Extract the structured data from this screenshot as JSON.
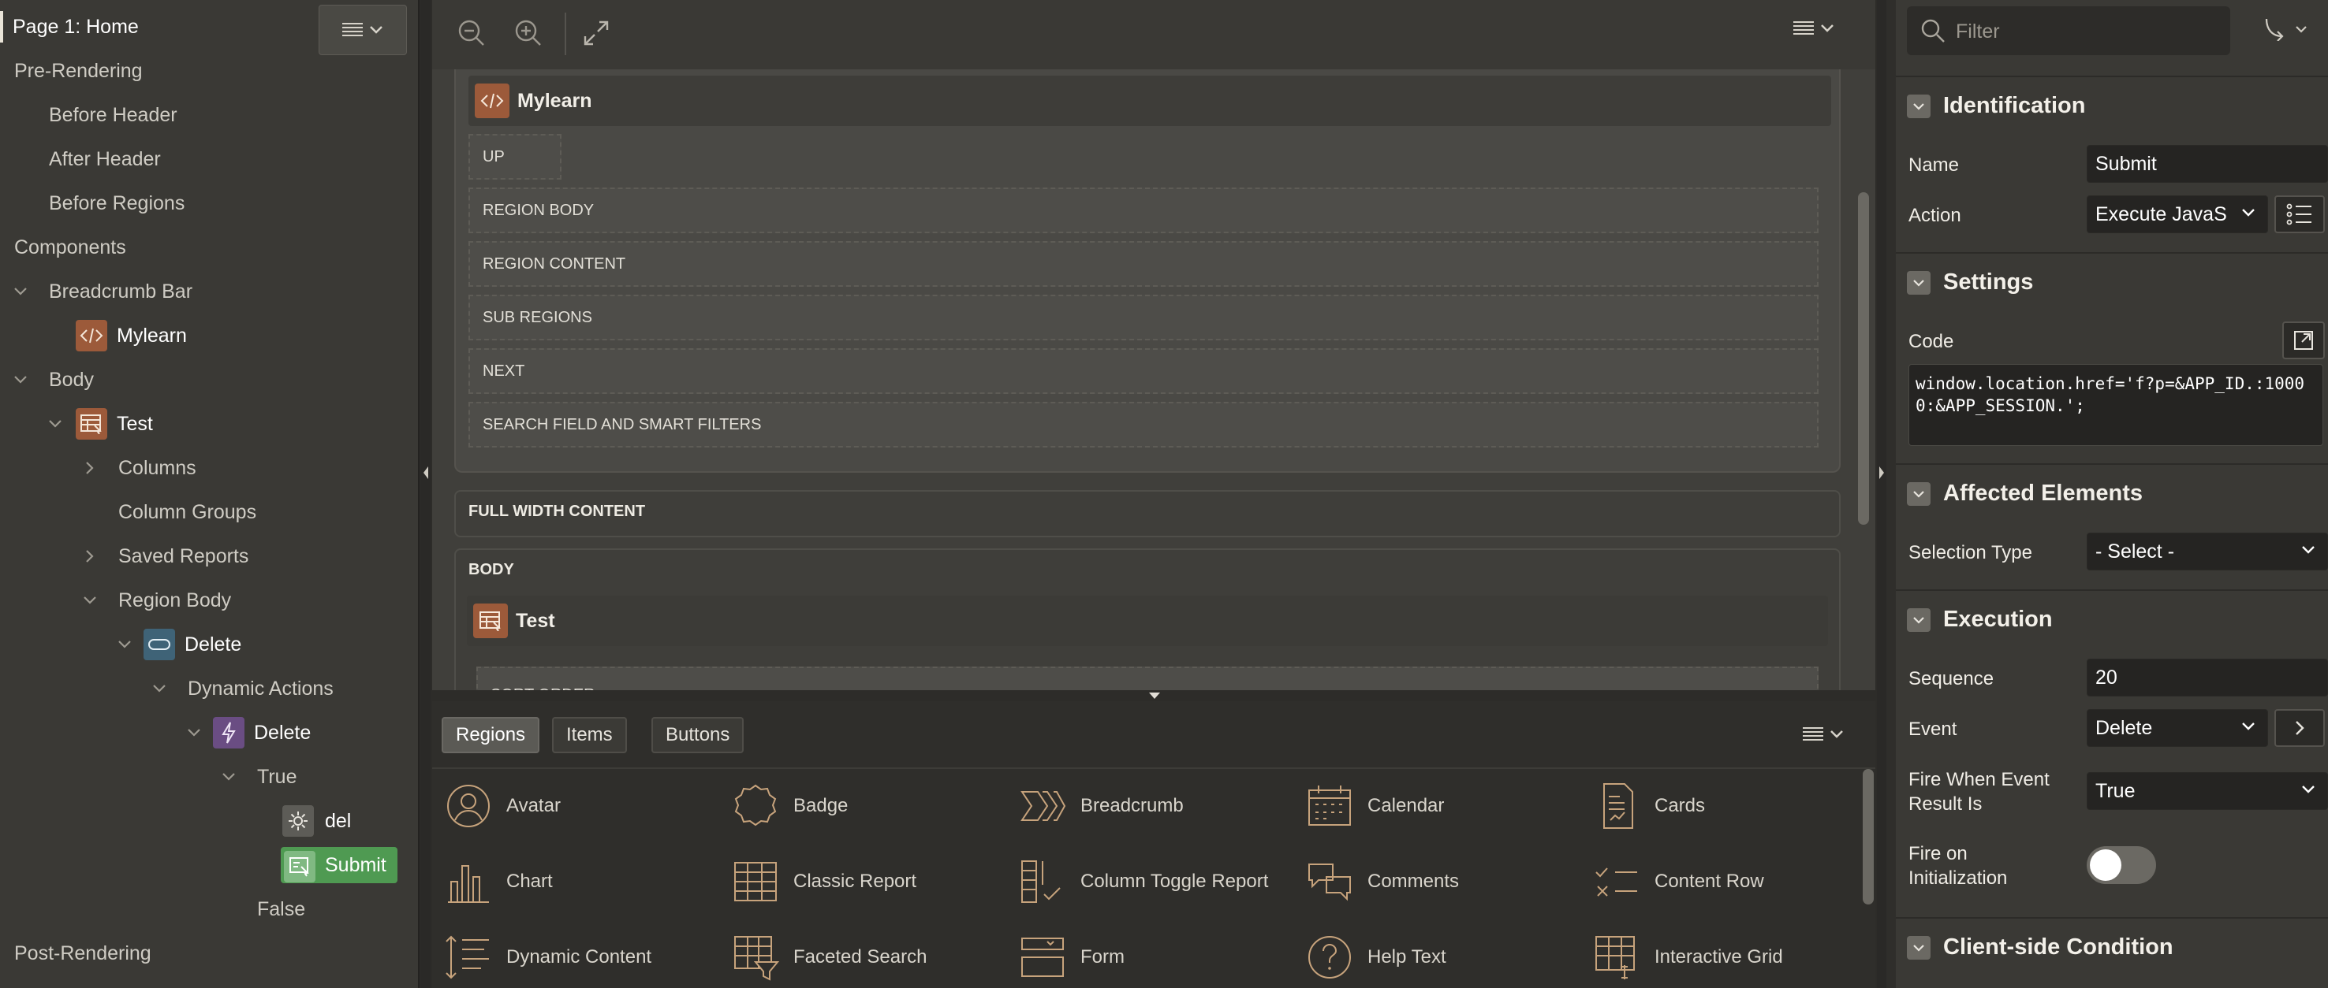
{
  "left_panel": {
    "page_title": "Page 1: Home",
    "tree": [
      {
        "label": "Pre-Rendering"
      },
      {
        "label": "Before Header"
      },
      {
        "label": "After Header"
      },
      {
        "label": "Before Regions"
      },
      {
        "label": "Components"
      },
      {
        "label": "Breadcrumb Bar"
      },
      {
        "label": "Mylearn"
      },
      {
        "label": "Body"
      },
      {
        "label": "Test"
      },
      {
        "label": "Columns"
      },
      {
        "label": "Column Groups"
      },
      {
        "label": "Saved Reports"
      },
      {
        "label": "Region Body"
      },
      {
        "label": "Delete"
      },
      {
        "label": "Dynamic Actions"
      },
      {
        "label": "Delete"
      },
      {
        "label": "True"
      },
      {
        "label": "del"
      },
      {
        "label": "Submit"
      },
      {
        "label": "False"
      },
      {
        "label": "Post-Rendering"
      }
    ]
  },
  "canvas": {
    "breadcrumb_region": "Mylearn",
    "slots": [
      "UP",
      "REGION BODY",
      "REGION CONTENT",
      "SUB REGIONS",
      "NEXT",
      "SEARCH FIELD AND SMART FILTERS"
    ],
    "full_width": "FULL WIDTH CONTENT",
    "body": "BODY",
    "body_region": "Test",
    "body_slot": "SORT ORDER"
  },
  "gallery": {
    "tabs": [
      "Regions",
      "Items",
      "Buttons"
    ],
    "items": [
      "Avatar",
      "Badge",
      "Breadcrumb",
      "Calendar",
      "Cards",
      "Chart",
      "Classic Report",
      "Column Toggle Report",
      "Comments",
      "Content Row",
      "Dynamic Content",
      "Faceted Search",
      "Form",
      "Help Text",
      "Interactive Grid"
    ]
  },
  "properties": {
    "filter_placeholder": "Filter",
    "identification": {
      "title": "Identification",
      "name_label": "Name",
      "name_value": "Submit",
      "action_label": "Action",
      "action_value": "Execute JavaScript Code"
    },
    "settings": {
      "title": "Settings",
      "code_label": "Code",
      "code_value": "window.location.href='f?p=&APP_ID.:10000:&APP_SESSION.';"
    },
    "affected": {
      "title": "Affected Elements",
      "selection_label": "Selection Type",
      "selection_value": "- Select -"
    },
    "execution": {
      "title": "Execution",
      "sequence_label": "Sequence",
      "sequence_value": "20",
      "event_label": "Event",
      "event_value": "Delete",
      "fire_label": "Fire When Event Result Is",
      "fire_value": "True",
      "init_label": "Fire on Initialization"
    },
    "client_condition": {
      "title": "Client-side Condition"
    }
  },
  "colors": {
    "accent_submit": "#4f9a52",
    "region_badge": "#9c5a3a",
    "gallery_icon": "#c7a37c"
  }
}
